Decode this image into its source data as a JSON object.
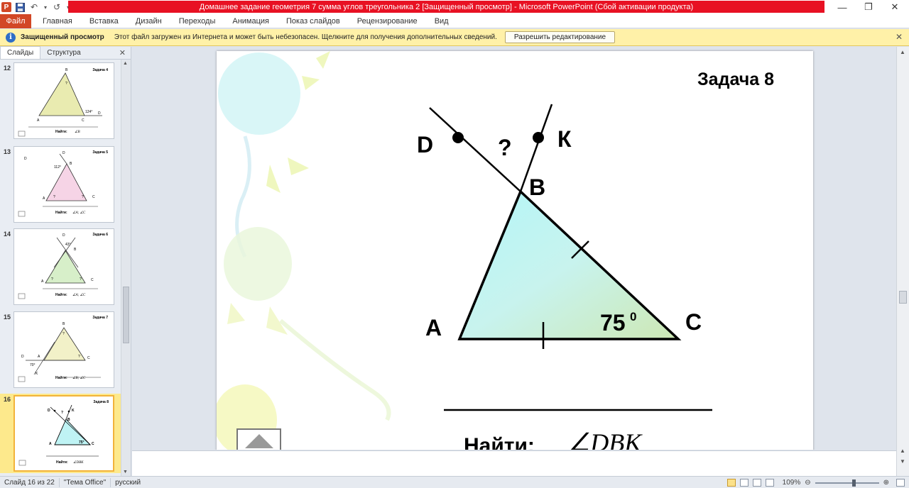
{
  "titlebar": {
    "title": "Домашнее задание геометрия 7 сумма углов треугольника 2 [Защищенный просмотр] - Microsoft PowerPoint (Сбой активации продукта)",
    "app_icon": "P",
    "minimize_icon": "—",
    "restore_icon": "❐",
    "close_icon": "✕"
  },
  "ribbon": {
    "file_tab": "Файл",
    "tabs": [
      "Главная",
      "Вставка",
      "Дизайн",
      "Переходы",
      "Анимация",
      "Показ слайдов",
      "Рецензирование",
      "Вид"
    ]
  },
  "message_bar": {
    "title": "Защищенный просмотр",
    "text": "Этот файл загружен из Интернета и может быть небезопасен. Щелкните для получения дополнительных сведений.",
    "button": "Разрешить редактирование"
  },
  "left_panel": {
    "tabs": [
      "Слайды",
      "Структура"
    ],
    "thumbnails": [
      {
        "num": "12",
        "title": "Задача 4",
        "find": "Найти:"
      },
      {
        "num": "13",
        "title": "Задача 5",
        "find": "Найти:"
      },
      {
        "num": "14",
        "title": "Задача 6",
        "find": "Найти:"
      },
      {
        "num": "15",
        "title": "Задача 7",
        "find": "Найти:"
      },
      {
        "num": "16",
        "title": "Задача 8",
        "find": "Найти:"
      }
    ]
  },
  "slide": {
    "title": "Задача 8",
    "labels": {
      "D": "D",
      "K": "К",
      "B": "B",
      "A": "A",
      "C": "C",
      "question": "?"
    },
    "angle_value": "75",
    "angle_sup": "0",
    "find_label": "Найти:",
    "find_formula": "∠DBK"
  },
  "statusbar": {
    "slide_info": "Слайд 16 из 22",
    "theme": "\"Тема Office\"",
    "language": "русский",
    "zoom": "109%"
  },
  "colors": {
    "accent_red": "#e81123",
    "file_tab": "#d24726",
    "message_bar": "#fff1a8"
  }
}
